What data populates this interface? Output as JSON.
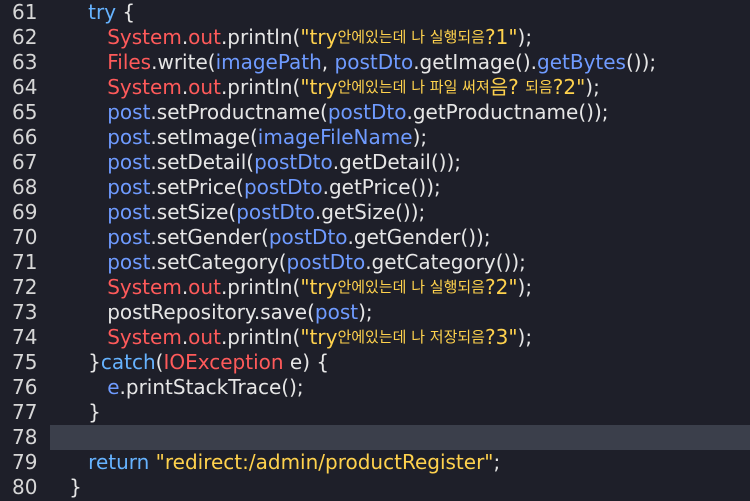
{
  "editor": {
    "lines": [
      {
        "no": "61",
        "indent": "      ",
        "tokens": [
          {
            "t": "try",
            "c": "kw"
          },
          {
            "t": " {",
            "c": "punc"
          }
        ]
      },
      {
        "no": "62",
        "indent": "         ",
        "tokens": [
          {
            "t": "System",
            "c": "cls"
          },
          {
            "t": ".",
            "c": "punc"
          },
          {
            "t": "out",
            "c": "mem"
          },
          {
            "t": ".println(",
            "c": "punc"
          },
          {
            "t": "\"try",
            "c": "str"
          },
          {
            "t": "안에있는데 나 실행되음",
            "c": "ko"
          },
          {
            "t": "?1\"",
            "c": "str"
          },
          {
            "t": ");",
            "c": "punc"
          }
        ]
      },
      {
        "no": "63",
        "indent": "         ",
        "tokens": [
          {
            "t": "Files",
            "c": "cls"
          },
          {
            "t": ".write(",
            "c": "punc"
          },
          {
            "t": "imagePath",
            "c": "var"
          },
          {
            "t": ", ",
            "c": "punc"
          },
          {
            "t": "postDto",
            "c": "var"
          },
          {
            "t": ".getImage().",
            "c": "punc"
          },
          {
            "t": "getBytes",
            "c": "var"
          },
          {
            "t": "());",
            "c": "punc"
          }
        ]
      },
      {
        "no": "64",
        "indent": "         ",
        "tokens": [
          {
            "t": "System",
            "c": "cls"
          },
          {
            "t": ".",
            "c": "punc"
          },
          {
            "t": "out",
            "c": "mem"
          },
          {
            "t": ".println(",
            "c": "punc"
          },
          {
            "t": "\"try",
            "c": "str"
          },
          {
            "t": "안에있는데 나 파일 써져",
            "c": "ko"
          },
          {
            "t": "음? ",
            "c": "str"
          },
          {
            "t": "되음",
            "c": "ko"
          },
          {
            "t": "?2\"",
            "c": "str"
          },
          {
            "t": ");",
            "c": "punc"
          }
        ]
      },
      {
        "no": "65",
        "indent": "         ",
        "tokens": [
          {
            "t": "post",
            "c": "var"
          },
          {
            "t": ".setProductname(",
            "c": "punc"
          },
          {
            "t": "postDto",
            "c": "var"
          },
          {
            "t": ".getProductname());",
            "c": "punc"
          }
        ]
      },
      {
        "no": "66",
        "indent": "         ",
        "tokens": [
          {
            "t": "post",
            "c": "var"
          },
          {
            "t": ".setImage(",
            "c": "punc"
          },
          {
            "t": "imageFileName",
            "c": "var"
          },
          {
            "t": ");",
            "c": "punc"
          }
        ]
      },
      {
        "no": "67",
        "indent": "         ",
        "tokens": [
          {
            "t": "post",
            "c": "var"
          },
          {
            "t": ".setDetail(",
            "c": "punc"
          },
          {
            "t": "postDto",
            "c": "var"
          },
          {
            "t": ".getDetail());",
            "c": "punc"
          }
        ]
      },
      {
        "no": "68",
        "indent": "         ",
        "tokens": [
          {
            "t": "post",
            "c": "var"
          },
          {
            "t": ".setPrice(",
            "c": "punc"
          },
          {
            "t": "postDto",
            "c": "var"
          },
          {
            "t": ".getPrice());",
            "c": "punc"
          }
        ]
      },
      {
        "no": "69",
        "indent": "         ",
        "tokens": [
          {
            "t": "post",
            "c": "var"
          },
          {
            "t": ".setSize(",
            "c": "punc"
          },
          {
            "t": "postDto",
            "c": "var"
          },
          {
            "t": ".getSize());",
            "c": "punc"
          }
        ]
      },
      {
        "no": "70",
        "indent": "         ",
        "tokens": [
          {
            "t": "post",
            "c": "var"
          },
          {
            "t": ".setGender(",
            "c": "punc"
          },
          {
            "t": "postDto",
            "c": "var"
          },
          {
            "t": ".getGender());",
            "c": "punc"
          }
        ]
      },
      {
        "no": "71",
        "indent": "         ",
        "tokens": [
          {
            "t": "post",
            "c": "var"
          },
          {
            "t": ".setCategory(",
            "c": "punc"
          },
          {
            "t": "postDto",
            "c": "var"
          },
          {
            "t": ".getCategory());",
            "c": "punc"
          }
        ]
      },
      {
        "no": "72",
        "indent": "         ",
        "tokens": [
          {
            "t": "System",
            "c": "cls"
          },
          {
            "t": ".",
            "c": "punc"
          },
          {
            "t": "out",
            "c": "mem"
          },
          {
            "t": ".println(",
            "c": "punc"
          },
          {
            "t": "\"try",
            "c": "str"
          },
          {
            "t": "안에있는데 나 실행되음",
            "c": "ko"
          },
          {
            "t": "?2\"",
            "c": "str"
          },
          {
            "t": ");",
            "c": "punc"
          }
        ]
      },
      {
        "no": "73",
        "indent": "         ",
        "tokens": [
          {
            "t": "postRepository.save(",
            "c": "punc"
          },
          {
            "t": "post",
            "c": "var"
          },
          {
            "t": ");",
            "c": "punc"
          }
        ]
      },
      {
        "no": "74",
        "indent": "         ",
        "tokens": [
          {
            "t": "System",
            "c": "cls"
          },
          {
            "t": ".",
            "c": "punc"
          },
          {
            "t": "out",
            "c": "mem"
          },
          {
            "t": ".println(",
            "c": "punc"
          },
          {
            "t": "\"try",
            "c": "str"
          },
          {
            "t": "안에있는데 나 저장되음",
            "c": "ko"
          },
          {
            "t": "?3\"",
            "c": "str"
          },
          {
            "t": ");",
            "c": "punc"
          }
        ]
      },
      {
        "no": "75",
        "indent": "      ",
        "tokens": [
          {
            "t": "}",
            "c": "punc"
          },
          {
            "t": "catch",
            "c": "kw"
          },
          {
            "t": "(",
            "c": "punc"
          },
          {
            "t": "IOException",
            "c": "cls"
          },
          {
            "t": " e) {",
            "c": "punc"
          }
        ]
      },
      {
        "no": "76",
        "indent": "         ",
        "tokens": [
          {
            "t": "e",
            "c": "var"
          },
          {
            "t": ".printStackTrace();",
            "c": "punc"
          }
        ]
      },
      {
        "no": "77",
        "indent": "      ",
        "tokens": [
          {
            "t": "}",
            "c": "punc"
          }
        ]
      },
      {
        "no": "78",
        "indent": "",
        "tokens": [],
        "current": true
      },
      {
        "no": "79",
        "indent": "      ",
        "tokens": [
          {
            "t": "return",
            "c": "kw"
          },
          {
            "t": " ",
            "c": "punc"
          },
          {
            "t": "\"redirect:/admin/productRegister\"",
            "c": "str"
          },
          {
            "t": ";",
            "c": "punc"
          }
        ]
      },
      {
        "no": "80",
        "indent": "   ",
        "tokens": [
          {
            "t": "}",
            "c": "punc"
          }
        ]
      }
    ]
  }
}
